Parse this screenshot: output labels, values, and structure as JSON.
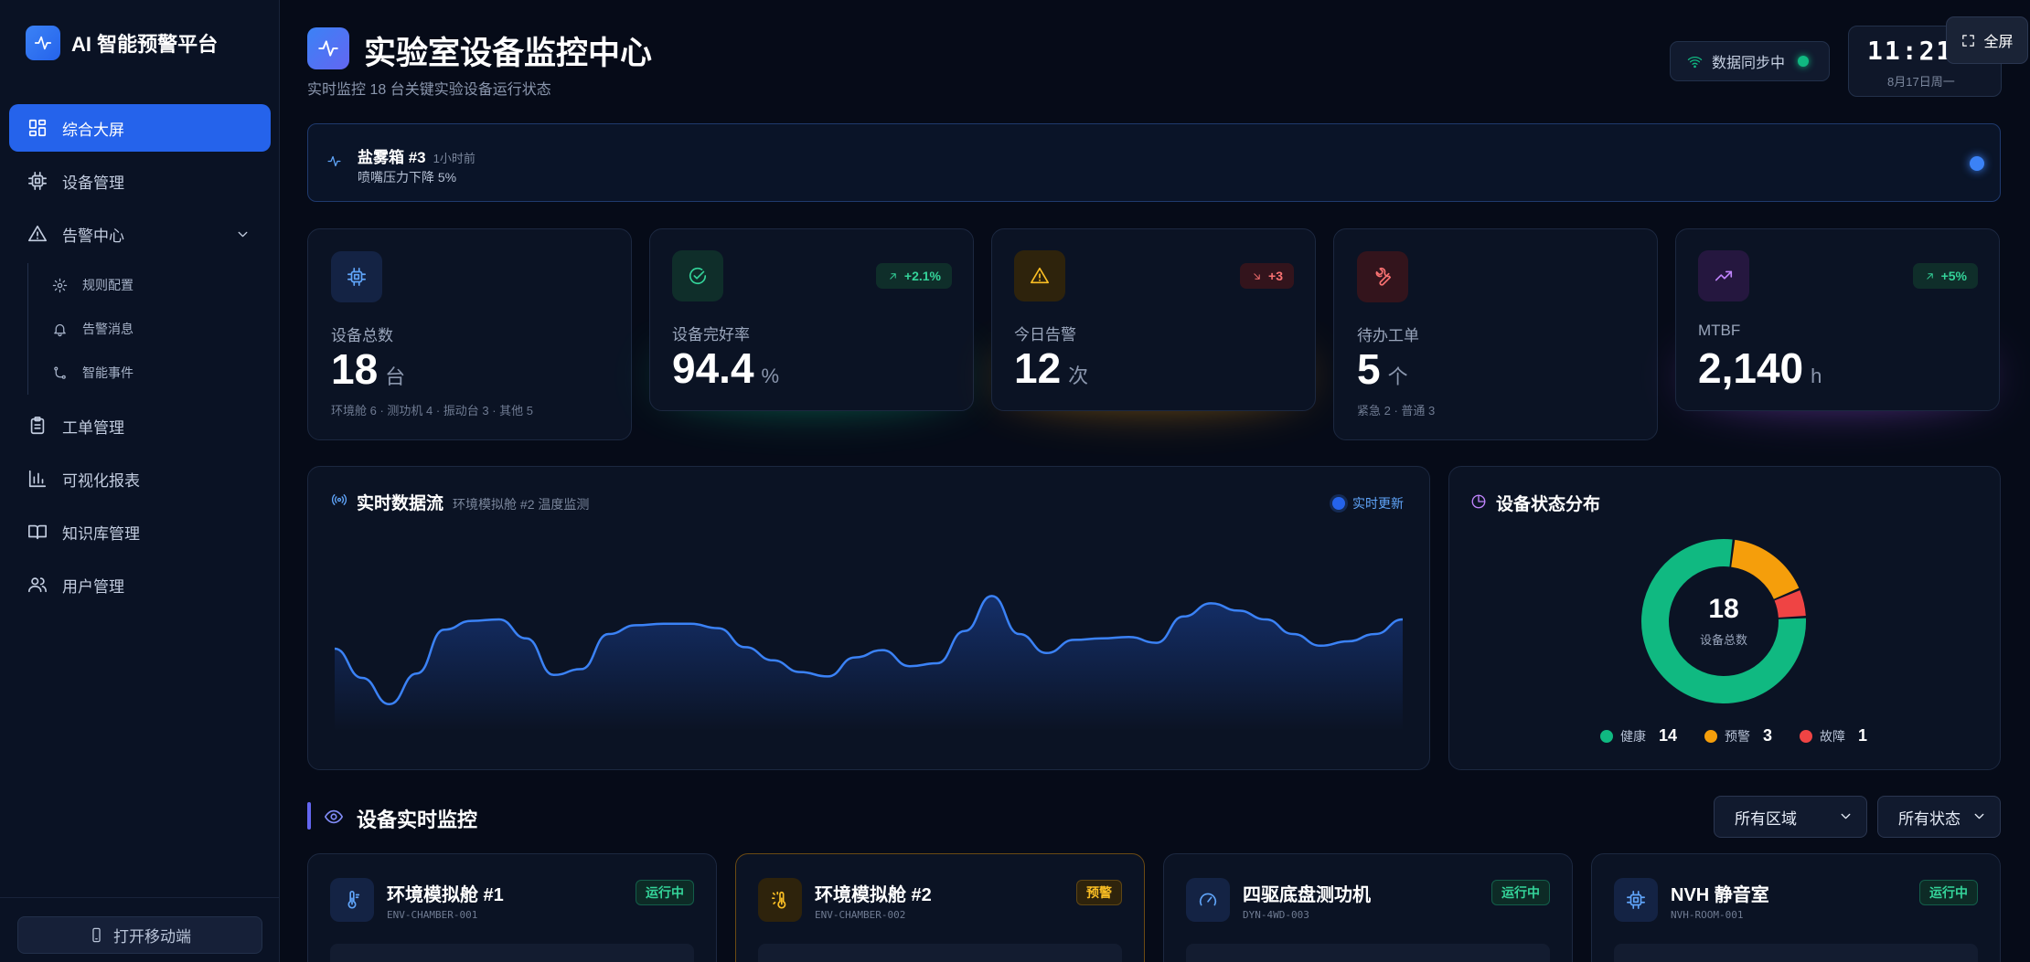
{
  "sidebar": {
    "brand": "AI 智能预警平台",
    "items": [
      {
        "label": "综合大屏"
      },
      {
        "label": "设备管理"
      },
      {
        "label": "告警中心"
      },
      {
        "label": "工单管理"
      },
      {
        "label": "可视化报表"
      },
      {
        "label": "知识库管理"
      },
      {
        "label": "用户管理"
      }
    ],
    "sub_items": [
      {
        "label": "规则配置"
      },
      {
        "label": "告警消息"
      },
      {
        "label": "智能事件"
      }
    ],
    "mobile_button": "打开移动端"
  },
  "header": {
    "title": "实验室设备监控中心",
    "subtitle": "实时监控 18 台关键实验设备运行状态",
    "sync_status": "数据同步中",
    "clock_time": "11:21:",
    "clock_date": "8月17日周一",
    "fullscreen": "全屏"
  },
  "ticker": {
    "title": "盐雾箱 #3",
    "time": "1小时前",
    "message": "喷嘴压力下降 5%"
  },
  "kpis": [
    {
      "label": "设备总数",
      "value": "18",
      "unit": "台",
      "foot": "环境舱 6 · 测功机 4 · 振动台 3 · 其他 5",
      "icon": "chip-icon",
      "color": "#3b82f6"
    },
    {
      "label": "设备完好率",
      "value": "94.4",
      "unit": "%",
      "badge": "+2.1%",
      "icon": "check-circle-icon",
      "color": "#10b981"
    },
    {
      "label": "今日告警",
      "value": "12",
      "unit": "次",
      "badge": "+3",
      "icon": "warning-icon",
      "color": "#f59e0b"
    },
    {
      "label": "待办工单",
      "value": "5",
      "unit": "个",
      "foot": "紧急 2 · 普通 3",
      "icon": "wrench-icon",
      "color": "#ef4444"
    },
    {
      "label": "MTBF",
      "value": "2,140",
      "unit": "h",
      "badge": "+5%",
      "icon": "trend-up-icon",
      "color": "#a855f7"
    }
  ],
  "stream": {
    "title": "实时数据流",
    "subtitle": "环境模拟舱 #2 温度监测",
    "live": "实时更新",
    "line_color": "#3b82f6",
    "chart_data": {
      "type": "area",
      "values": [
        50,
        30,
        12,
        33,
        63,
        69,
        70,
        57,
        32,
        36,
        60,
        66,
        67,
        67,
        64,
        51,
        42,
        34,
        31,
        44,
        49,
        38,
        40,
        62,
        86,
        60,
        47,
        56,
        57,
        58,
        54,
        72,
        81,
        76,
        70,
        60,
        52,
        55,
        60,
        70
      ]
    }
  },
  "status": {
    "title": "设备状态分布",
    "total": "18",
    "total_label": "设备总数",
    "chart_data": {
      "type": "pie",
      "slices": [
        {
          "name": "健康",
          "value": 14,
          "color": "#10b981"
        },
        {
          "name": "预警",
          "value": 3,
          "color": "#f59e0b"
        },
        {
          "name": "故障",
          "value": 1,
          "color": "#ef4444"
        }
      ]
    }
  },
  "monitor": {
    "title": "设备实时监控",
    "filters": [
      "所有区域",
      "所有状态"
    ],
    "devices": [
      {
        "name": "环境模拟舱 #1",
        "code": "ENV-CHAMBER-001",
        "status": "运行中",
        "icon": "thermometer-icon",
        "warn": false
      },
      {
        "name": "环境模拟舱 #2",
        "code": "ENV-CHAMBER-002",
        "status": "预警",
        "icon": "thermometer-sun-icon",
        "warn": true
      },
      {
        "name": "四驱底盘测功机",
        "code": "DYN-4WD-003",
        "status": "运行中",
        "icon": "gauge-icon",
        "warn": false
      },
      {
        "name": "NVH 静音室",
        "code": "NVH-ROOM-001",
        "status": "运行中",
        "icon": "chip-icon",
        "warn": false
      }
    ]
  }
}
